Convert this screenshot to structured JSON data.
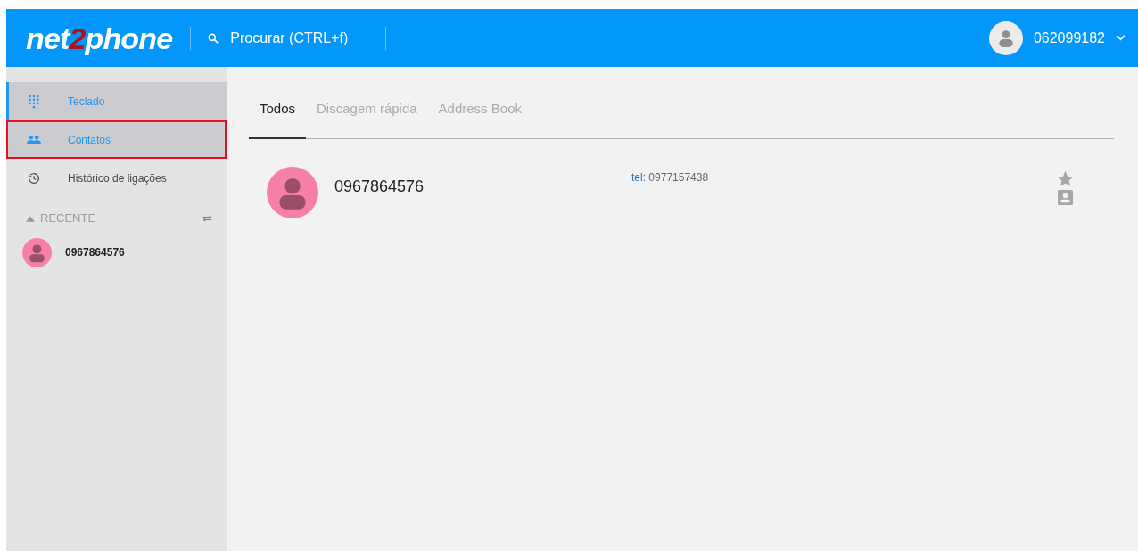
{
  "header": {
    "logo": {
      "before": "net",
      "accent": "2",
      "after": "phone"
    },
    "search": {
      "placeholder": "Procurar (CTRL+f)"
    },
    "account": "062099182"
  },
  "sidebar": {
    "items": [
      {
        "label": "Teclado",
        "kind": "dialpad",
        "selected": true,
        "highlighted": false
      },
      {
        "label": "Contatos",
        "kind": "people",
        "selected": false,
        "highlighted": true
      },
      {
        "label": "Histórico de ligações",
        "kind": "history",
        "selected": false,
        "highlighted": false
      }
    ],
    "recent": {
      "title": "RECENTE",
      "expanded": true,
      "items": [
        {
          "name": "0967864576"
        }
      ]
    }
  },
  "tabs": [
    {
      "label": "Todos",
      "selected": true
    },
    {
      "label": "Discagem rápida",
      "selected": false
    },
    {
      "label": "Address Book",
      "selected": false
    }
  ],
  "contacts": [
    {
      "name": "0967864576",
      "phone_label": "tel:",
      "phone": "0977157438",
      "favorite": false
    }
  ]
}
